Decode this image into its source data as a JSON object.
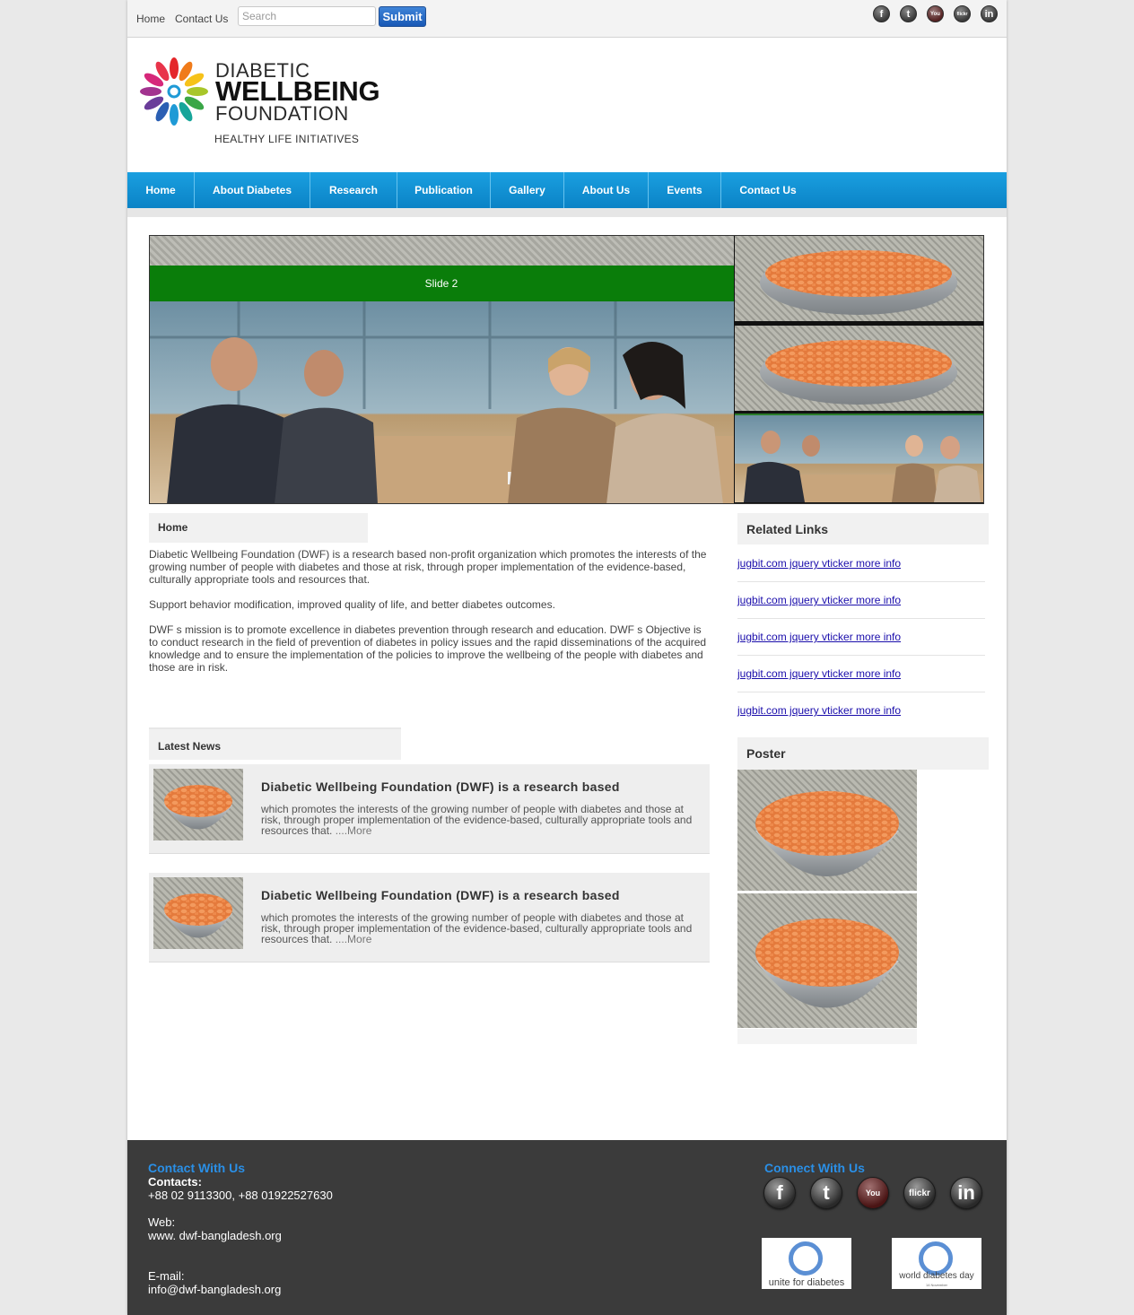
{
  "topbar": {
    "links": [
      "Home",
      "Contact Us"
    ],
    "search_placeholder": "Search",
    "submit_label": "Submit",
    "social_icons": [
      "facebook-icon",
      "twitter-icon",
      "youtube-icon",
      "flickr-icon",
      "linkedin-icon"
    ]
  },
  "logo": {
    "line1": "DIABETIC",
    "line2": "WELLBEING",
    "line3": "FOUNDATION",
    "tagline": "HEALTHY LIFE INITIATIVES"
  },
  "nav": {
    "items": [
      "Home",
      "About Diabetes",
      "Research",
      "Publication",
      "Gallery",
      "About Us",
      "Events",
      "Contact Us"
    ]
  },
  "slider": {
    "caption": "Slide 2"
  },
  "main": {
    "home_heading": "Home",
    "paragraphs": [
      "Diabetic Wellbeing Foundation (DWF) is a research based non-profit organization which promotes the interests of the growing number of people with diabetes and those at risk, through proper implementation of the evidence-based, culturally appropriate tools and resources that.",
      "Support behavior modification, improved quality of life, and better diabetes outcomes.",
      "DWF s mission is to promote excellence in diabetes prevention through research and education. DWF s Objective is to conduct research in the field of prevention of diabetes in policy issues and the rapid disseminations of the acquired knowledge and to ensure the implementation of the policies to improve the wellbeing of the people with diabetes and those are in risk."
    ],
    "news_heading": "Latest News",
    "news": [
      {
        "title": "Diabetic Wellbeing Foundation (DWF) is a research based",
        "text": "which promotes the interests of the growing number of people with diabetes and those at risk, through proper implementation of the evidence-based, culturally appropriate tools and resources that.",
        "more": "....More"
      },
      {
        "title": "Diabetic Wellbeing Foundation (DWF) is a research based",
        "text": "which promotes the interests of the growing number of people with diabetes and those at risk, through proper implementation of the evidence-based, culturally appropriate tools and resources that.",
        "more": "....More"
      }
    ]
  },
  "sidebar": {
    "related_heading": "Related Links",
    "related_links": [
      "jugbit.com jquery vticker more info",
      "jugbit.com jquery vticker more info",
      "jugbit.com jquery vticker more info",
      "jugbit.com jquery vticker more info",
      "jugbit.com jquery vticker more info"
    ],
    "poster_heading": "Poster"
  },
  "footer": {
    "contact_heading": "Contact With Us",
    "contacts_label": "Contacts:",
    "phone": "+88 02 9113300, +88 01922527630",
    "web_label": "Web:",
    "web": "www. dwf-bangladesh.org",
    "email_label": "E-mail:",
    "email": "info@dwf-bangladesh.org",
    "connect_heading": "Connect With Us",
    "badge1": "unite for diabetes",
    "badge2": "world diabetes day",
    "badge2_sub": "14 November"
  },
  "colors": {
    "nav_blue": "#0b8fd6",
    "slide_bar_green": "#0a7d0a",
    "footer_bg": "#3b3b3b",
    "footer_heading": "#2a8fe6",
    "submit_blue": "#1d5fbf"
  }
}
